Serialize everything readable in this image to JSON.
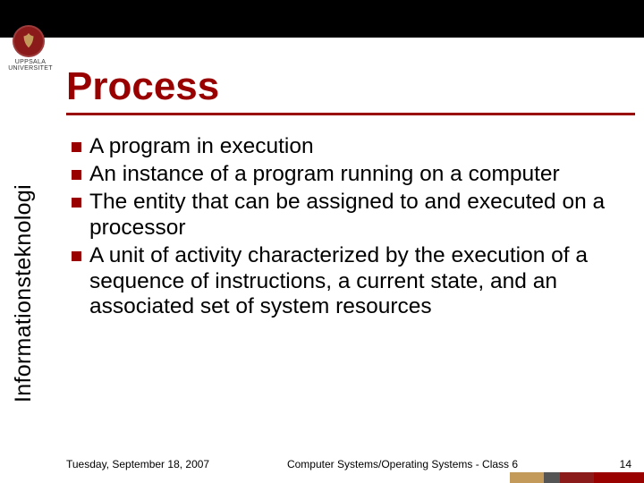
{
  "header": {
    "university_top": "UPPSALA",
    "university_bottom": "UNIVERSITET",
    "title": "Process"
  },
  "sidebar": {
    "label": "Informationsteknologi"
  },
  "bullets": [
    "A program in execution",
    "An instance of a program running on a computer",
    "The entity that can be assigned to and executed on a processor",
    "A unit of activity characterized by the execution of a sequence of instructions, a current state, and an associated set of system resources"
  ],
  "footer": {
    "date": "Tuesday, September 18, 2007",
    "course": "Computer Systems/Operating Systems - Class 6",
    "page": "14"
  },
  "colors": {
    "accent": "#990000",
    "seal": "#8b1a1a",
    "gold": "#c49a5a"
  }
}
